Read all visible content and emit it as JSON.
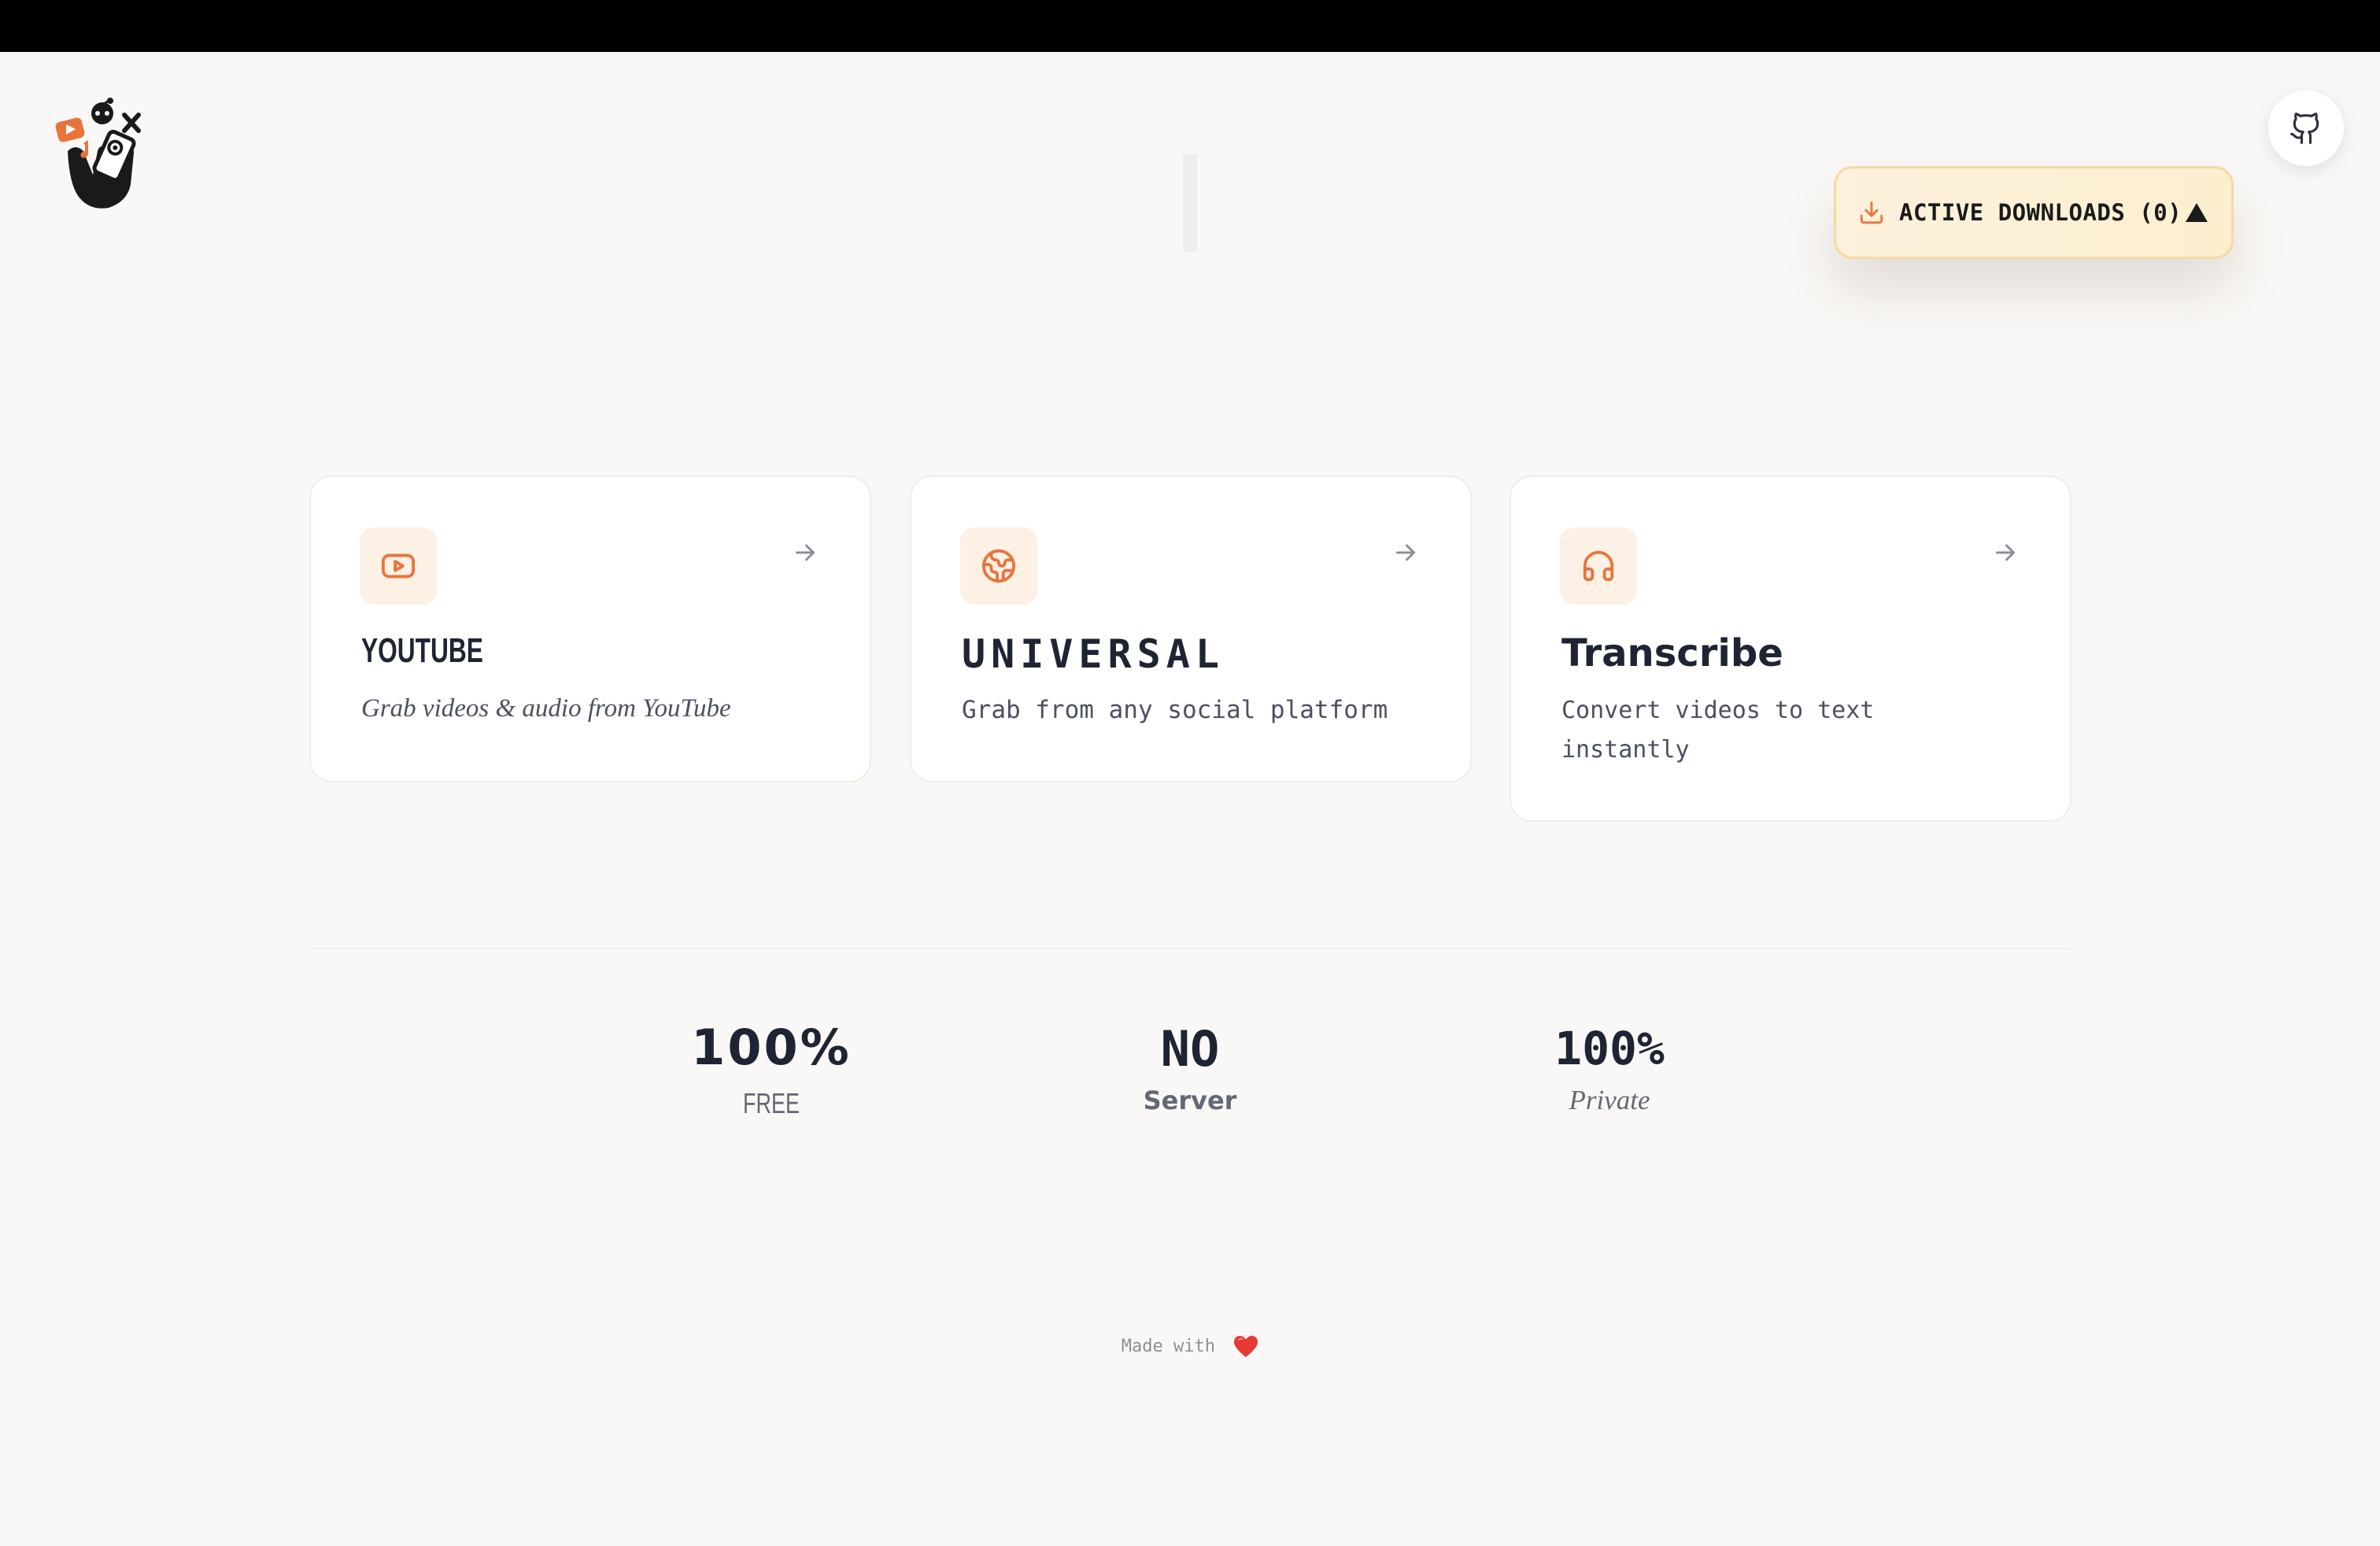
{
  "header": {
    "logo_icon": "hand-with-social-icons-logo",
    "github_icon": "github-icon"
  },
  "downloads": {
    "label": "ACTIVE DOWNLOADS (0)",
    "icon": "download-icon",
    "toggle_icon": "triangle-up-icon"
  },
  "cards": [
    {
      "title": "YOUTUBE",
      "description": "Grab videos & audio from YouTube",
      "icon": "youtube-icon"
    },
    {
      "title": "UNIVERSAL",
      "description": "Grab from any social platform",
      "icon": "globe-icon"
    },
    {
      "title": "Transcribe",
      "description": "Convert videos to text instantly",
      "icon": "headphones-icon"
    }
  ],
  "stats": [
    {
      "value": "100%",
      "label": "FREE"
    },
    {
      "value": "NO",
      "label": "Server"
    },
    {
      "value": "100%",
      "label": "Private"
    }
  ],
  "footer": {
    "text": "Made with",
    "icon": "heart-icon"
  },
  "colors": {
    "background": "#faf8f6",
    "accent": "#e8743b",
    "text": "#1e2433",
    "pill_border": "#f6d9a4",
    "pill_background": "#fdf0dc"
  }
}
